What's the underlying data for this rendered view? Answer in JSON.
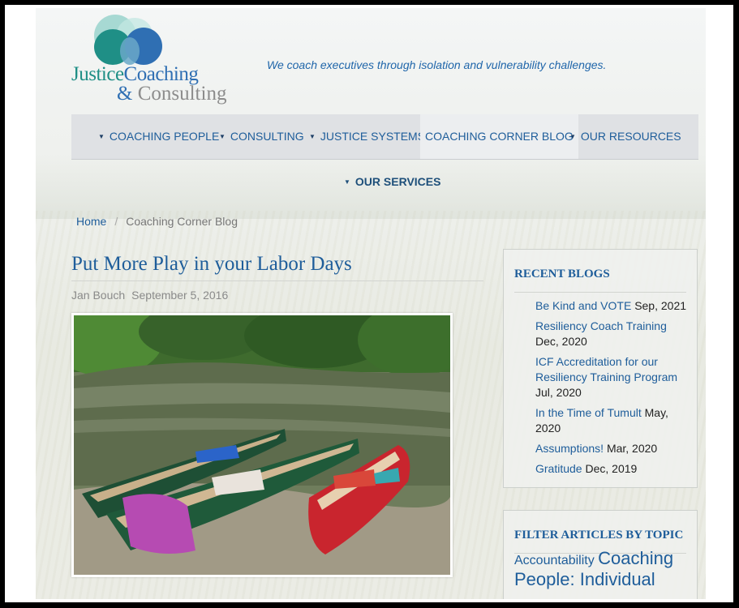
{
  "logo": {
    "line1a": "Justice",
    "line1b": "Coaching",
    "line2a": "&",
    "line2b": " Consulting"
  },
  "tagline": "We coach executives through isolation and vulnerability challenges.",
  "nav": {
    "items": [
      {
        "label": "COACHING PEOPLE",
        "dropdown": true
      },
      {
        "label": "CONSULTING",
        "dropdown": true
      },
      {
        "label": "JUSTICE SYSTEMS",
        "dropdown": true
      },
      {
        "label": "COACHING CORNER BLOG",
        "dropdown": false,
        "active": true
      },
      {
        "label": "OUR RESOURCES",
        "dropdown": true
      }
    ],
    "second_row": {
      "label": "OUR SERVICES",
      "dropdown": true
    }
  },
  "breadcrumb": {
    "home": "Home",
    "separator": "/",
    "current": "Coaching Corner Blog"
  },
  "post": {
    "title": "Put More Play in your Labor Days",
    "author": "Jan Bouch",
    "date": "September 5, 2016"
  },
  "recent_blogs": {
    "heading": "RECENT BLOGS",
    "items": [
      {
        "title": "Be Kind and VOTE",
        "date": "Sep, 2021"
      },
      {
        "title": "Resiliency Coach Training",
        "date": "Dec, 2020"
      },
      {
        "title_line1": "ICF Accreditation for our",
        "title_line2": "Resiliency Training Program",
        "date": "Jul, 2020"
      },
      {
        "title": "In the Time of Tumult",
        "date_line1": "May,",
        "date_line2": "2020"
      },
      {
        "title": "Assumptions!",
        "date": "Mar, 2020"
      },
      {
        "title": "Gratitude",
        "date": "Dec, 2019"
      }
    ]
  },
  "filter": {
    "heading": "FILTER ARTICLES BY TOPIC",
    "topics": [
      {
        "label": "Accountability"
      },
      {
        "label": "Coaching"
      },
      {
        "label": "People: Individual"
      }
    ]
  },
  "colors": {
    "link": "#1e5d9a",
    "nav_bg": "#dfe1e4",
    "heading": "#1e5d9a",
    "logo_teal": "#1f8f86",
    "logo_blue": "#2f6fb3"
  },
  "icons": {
    "dropdown": "caret-down-icon"
  }
}
